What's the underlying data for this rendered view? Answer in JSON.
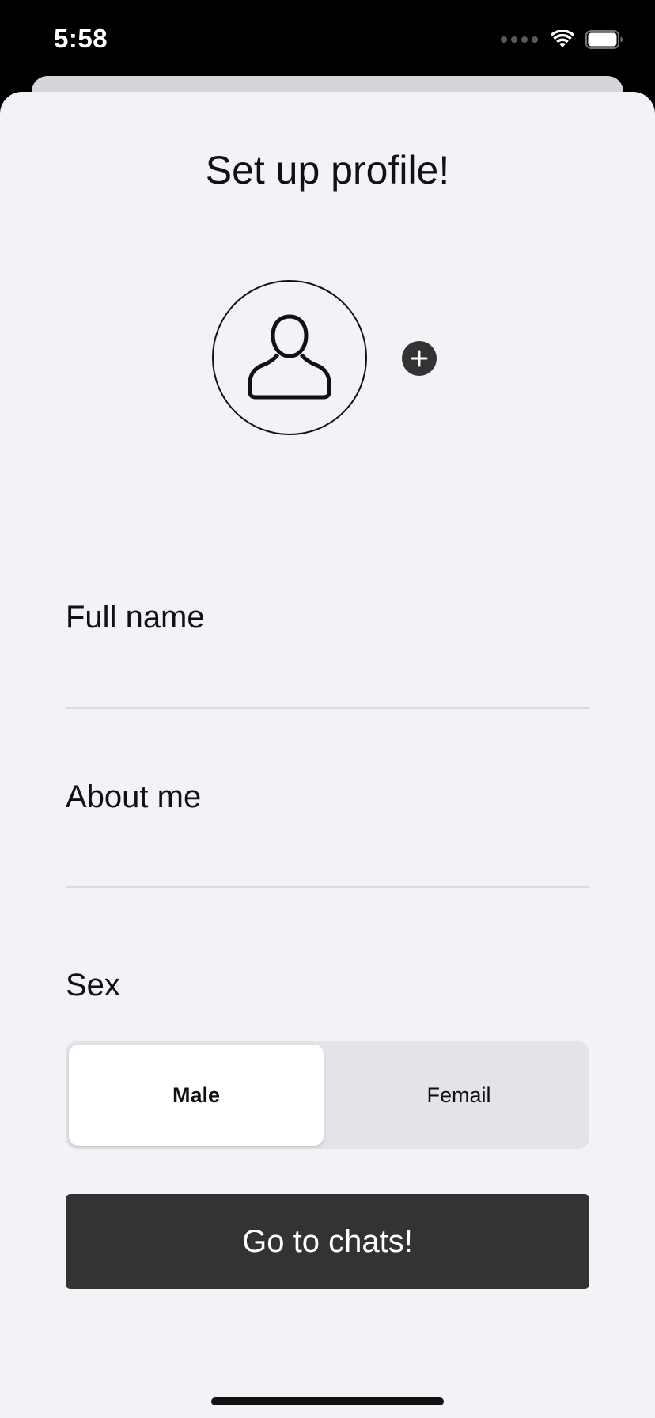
{
  "status_bar": {
    "time": "5:58"
  },
  "profile": {
    "title": "Set up profile!",
    "avatar_icon": "person-outline-icon",
    "add_photo_icon": "plus-circle-icon"
  },
  "form": {
    "full_name": {
      "label": "Full name",
      "value": "",
      "placeholder": ""
    },
    "about_me": {
      "label": "About me",
      "value": "",
      "placeholder": ""
    },
    "sex": {
      "label": "Sex",
      "options": [
        "Male",
        "Femail"
      ],
      "selected": "Male"
    }
  },
  "actions": {
    "go_to_chats_label": "Go to chats!"
  },
  "colors": {
    "background": "#f2f2f7",
    "button_dark": "#333333",
    "selected_segment": "#ffffff",
    "segment_track": "#e4e4e8"
  }
}
